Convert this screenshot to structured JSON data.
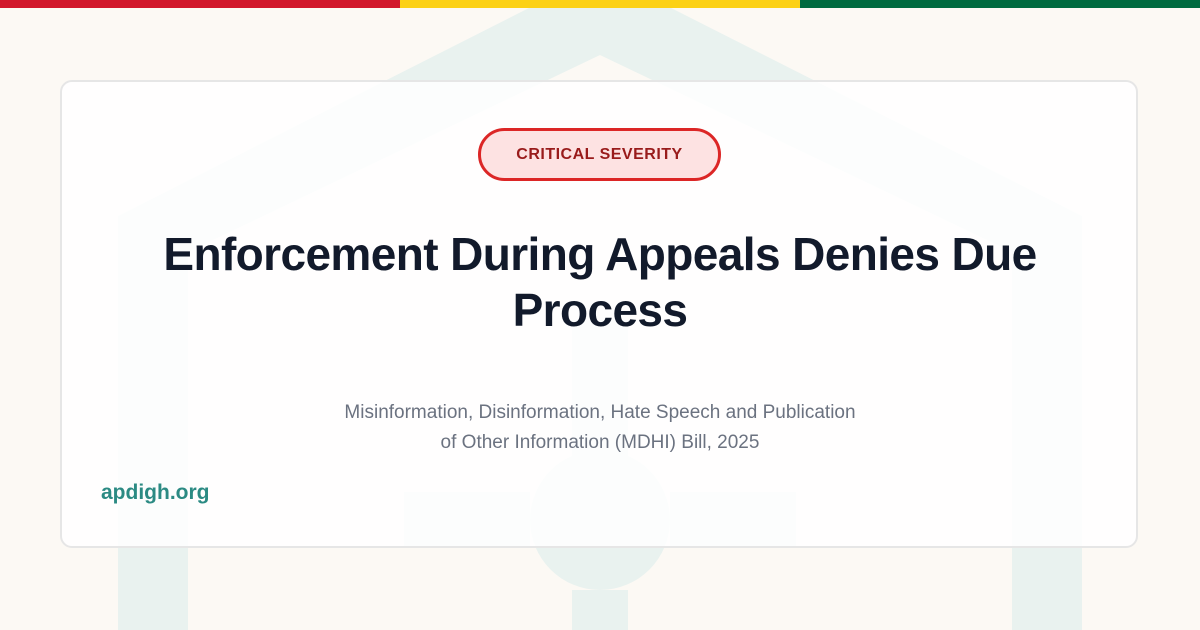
{
  "theme": {
    "stripe_colors": [
      "#d2182b",
      "#fcd116",
      "#006b3f"
    ],
    "watermark_color": "#e9f2ef",
    "badge_border": "#dc2626",
    "badge_bg": "#fde2e2",
    "badge_text": "#991b1b",
    "title_color": "#121a2b",
    "subtitle_color": "#6b7280",
    "site_color": "#2b8a83"
  },
  "badge": {
    "label": "CRITICAL SEVERITY"
  },
  "headline": {
    "title": "Enforcement During Appeals Denies Due Process"
  },
  "subtitle": {
    "line1": "Misinformation, Disinformation, Hate Speech and Publication",
    "line2": "of Other Information (MDHI) Bill, 2025"
  },
  "footer": {
    "site": "apdigh.org"
  },
  "watermark": {
    "icon": "house-person-logo-icon"
  }
}
